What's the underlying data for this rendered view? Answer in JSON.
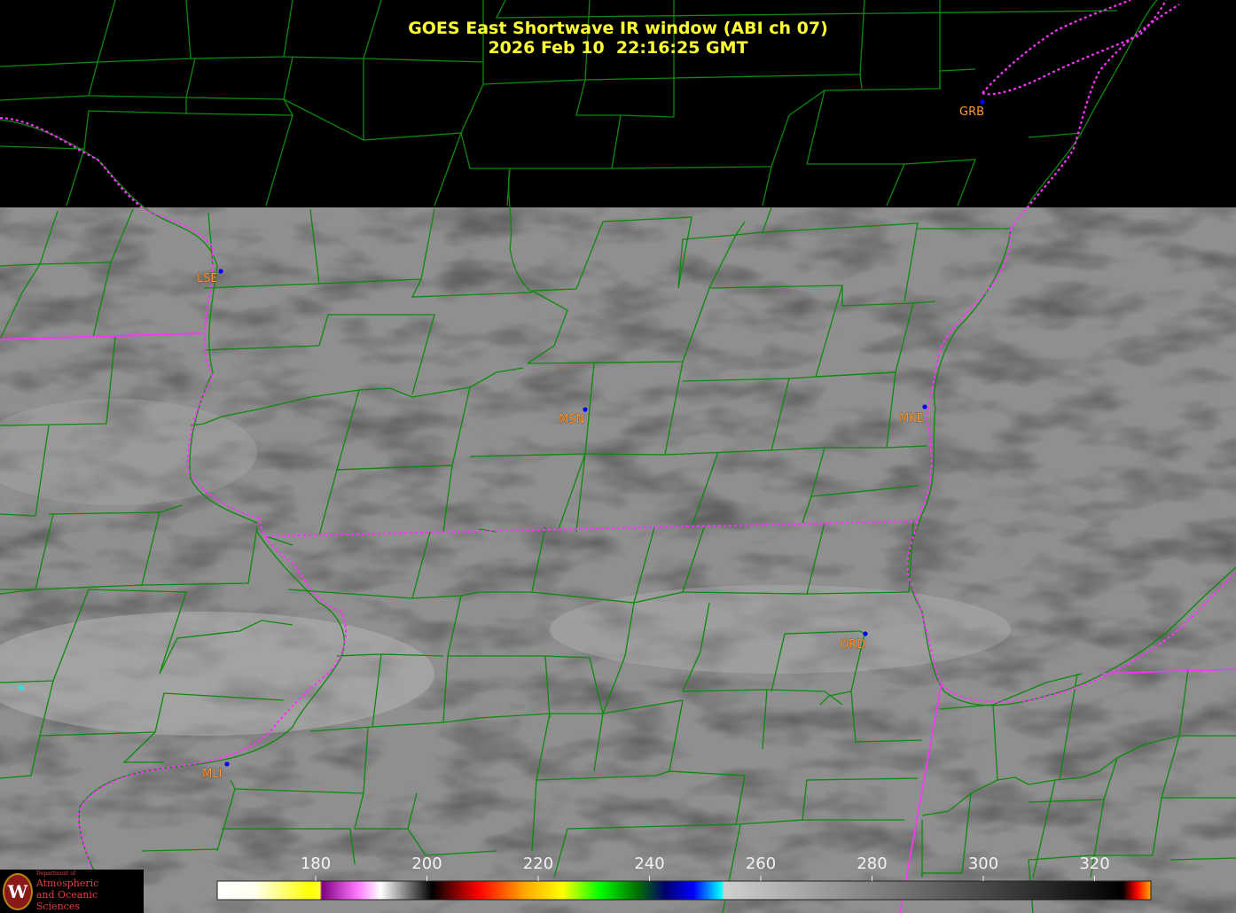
{
  "title": {
    "line1": "GOES East Shortwave IR window (ABI ch 07)",
    "line2": "2026 Feb 10  22:16:25 GMT"
  },
  "stations": [
    {
      "id": "lse",
      "label": "LSE"
    },
    {
      "id": "msn",
      "label": "MSN"
    },
    {
      "id": "mke",
      "label": "MKE"
    },
    {
      "id": "ord",
      "label": "ORD"
    },
    {
      "id": "mli",
      "label": "MLI"
    },
    {
      "id": "grb",
      "label": "GRB"
    }
  ],
  "colorbar": {
    "ticks": [
      "180",
      "200",
      "220",
      "240",
      "260",
      "280",
      "300",
      "320"
    ],
    "stops": [
      "#ffffff",
      "#ffff00",
      "#ffff40",
      "#800080",
      "#ff80ff",
      "#ffffff",
      "#000000",
      "#ff0000",
      "#ffa500",
      "#ffff00",
      "#00ff00",
      "#008000",
      "#000080",
      "#00ffff",
      "#c8c8c8",
      "#000000",
      "#ff0000",
      "#ffa500"
    ]
  },
  "colors": {
    "title": "#ffff33",
    "state_border": "#ff33ff",
    "county_line": "#00aa00",
    "station_label": "#ff9933",
    "station_dot": "#0000ff"
  },
  "logo": {
    "line1": "Department of",
    "line2": "Atmospheric",
    "line3": "and Oceanic Sciences"
  }
}
